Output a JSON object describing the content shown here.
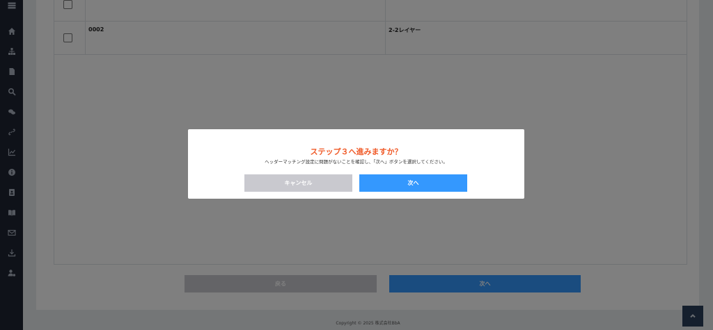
{
  "sidebar": {
    "icons": [
      "menu-icon",
      "home-icon",
      "sitemap-icon",
      "file-icon",
      "search-icon",
      "chat-icon",
      "link-icon",
      "chart-icon",
      "info-icon",
      "address-book-icon",
      "book-icon",
      "mail-icon",
      "download-icon",
      "user-cog-icon"
    ]
  },
  "table": {
    "rows": [
      {
        "code": "",
        "name": ""
      },
      {
        "code": "0002",
        "name": "2-2レイヤー"
      }
    ]
  },
  "actions": {
    "back_label": "戻る",
    "next_label": "次へ"
  },
  "footer": {
    "copyright": "Copyright © 2025 株式会社BbA"
  },
  "modal": {
    "title": "ステップ３へ進みますか？",
    "message": "ヘッダーマッチング設定に問題がないことを確認し、「次へ」ボタンを選択してください。",
    "cancel_label": "キャンセル",
    "next_label": "次へ"
  },
  "colors": {
    "sidebar": "#1f2533",
    "accent": "#3498fe",
    "title": "#f05a28",
    "disabled": "#c9c9cf"
  }
}
